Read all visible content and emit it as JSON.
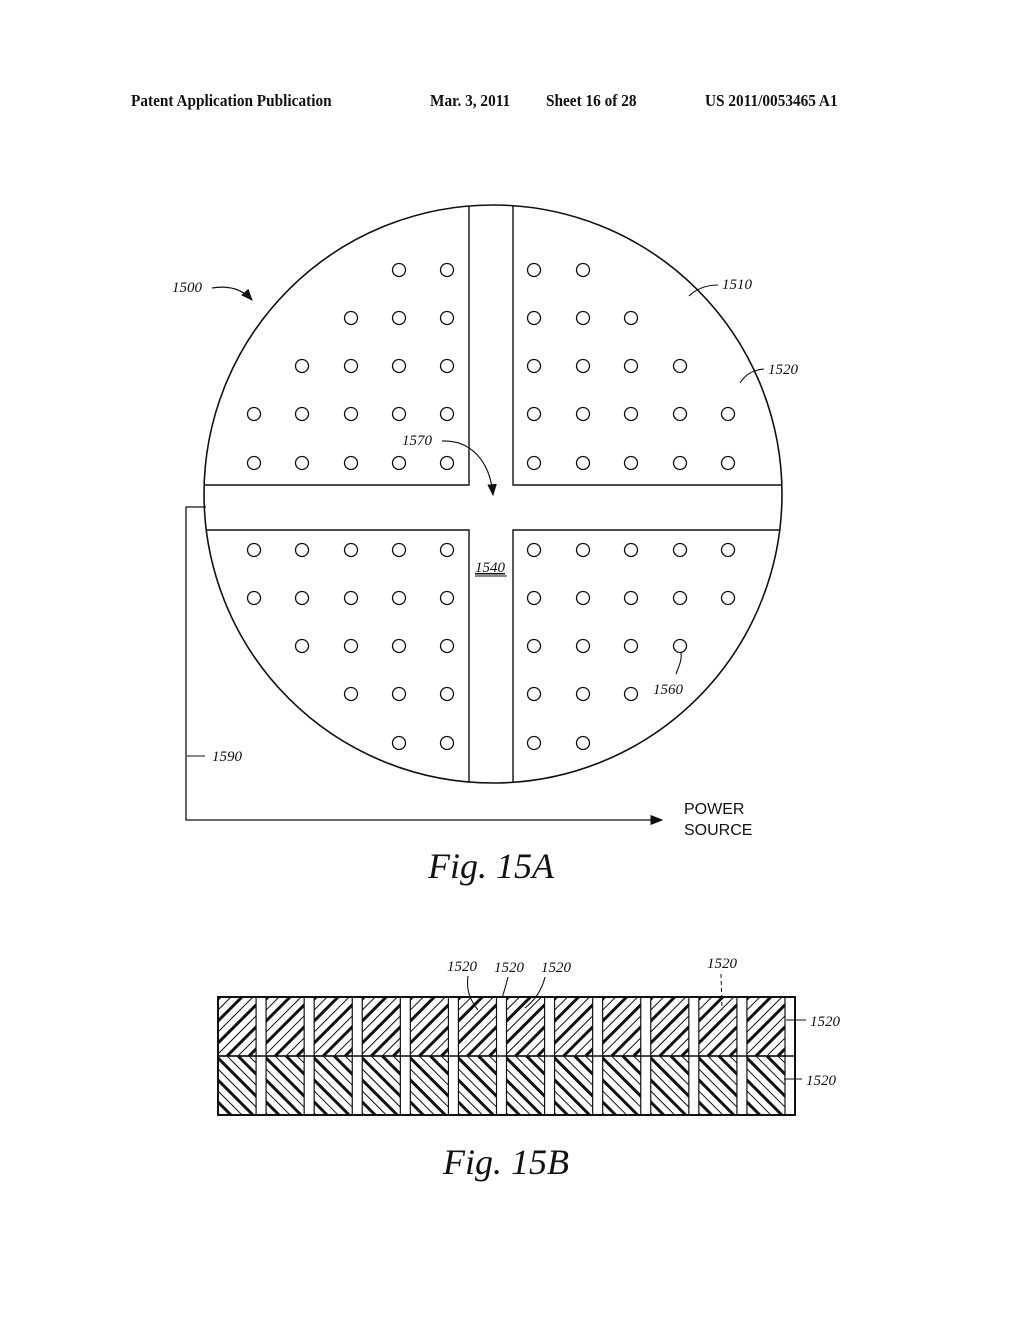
{
  "header": {
    "publication": "Patent Application Publication",
    "date": "Mar. 3, 2011",
    "sheet": "Sheet 16 of 28",
    "number": "US 2011/0053465 A1"
  },
  "fig15a": {
    "caption": "Fig. 15A",
    "labels": {
      "device": "1500",
      "wafer": "1510",
      "segment": "1520",
      "channel": "1540",
      "hole": "1560",
      "center": "1570",
      "lead": "1590"
    },
    "power_source_line1": "POWER",
    "power_source_line2": "SOURCE",
    "hole_rows": {
      "top_left": [
        [
          3,
          4
        ],
        [
          2,
          3,
          4
        ],
        [
          1,
          2,
          3,
          4
        ],
        [
          0,
          1,
          2,
          3,
          4
        ],
        [
          0,
          1,
          2,
          3,
          4
        ]
      ],
      "top_right": [
        [
          0,
          1
        ],
        [
          0,
          1,
          2
        ],
        [
          0,
          1,
          2,
          3
        ],
        [
          0,
          1,
          2,
          3,
          4
        ],
        [
          0,
          1,
          2,
          3,
          4
        ]
      ],
      "bottom_left": [
        [
          0,
          1,
          2,
          3,
          4
        ],
        [
          0,
          1,
          2,
          3,
          4
        ],
        [
          1,
          2,
          3,
          4
        ],
        [
          2,
          3,
          4
        ],
        [
          3,
          4
        ]
      ],
      "bottom_right": [
        [
          0,
          1,
          2,
          3,
          4
        ],
        [
          0,
          1,
          2,
          3,
          4
        ],
        [
          0,
          1,
          2,
          3
        ],
        [
          0,
          1,
          2
        ],
        [
          0,
          1
        ]
      ]
    }
  },
  "fig15b": {
    "caption": "Fig. 15B",
    "labels": [
      "1520",
      "1520",
      "1520",
      "1520",
      "1520",
      "1520"
    ],
    "cell_count": 12
  }
}
